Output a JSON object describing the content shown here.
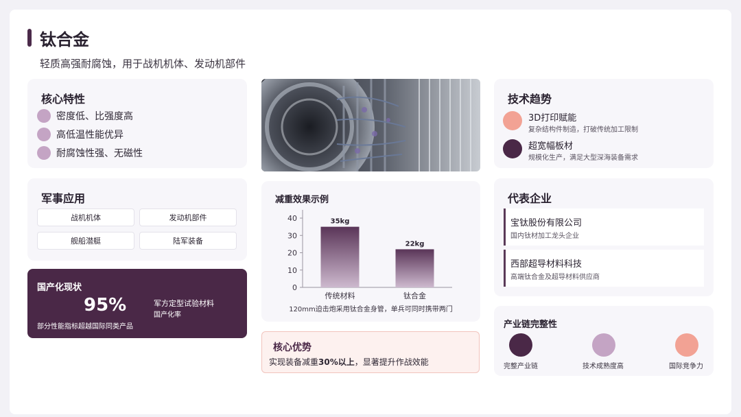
{
  "header": {
    "title": "钛合金",
    "subtitle": "轻质高强耐腐蚀，用于战机机体、发动机部件"
  },
  "core": {
    "title": "核心特性",
    "items": [
      "密度低、比强度高",
      "高低温性能优异",
      "耐腐蚀性强、无磁性"
    ]
  },
  "military": {
    "title": "军事应用",
    "items": [
      "战机机体",
      "发动机部件",
      "舰船潜艇",
      "陆军装备"
    ]
  },
  "status": {
    "title": "国产化现状",
    "percent": "95%",
    "line1": "军方定型试验材料",
    "line2": "国产化率",
    "footer": "部分性能指标超越国际同类产品"
  },
  "photo": {
    "icon": "jet-engine-photo"
  },
  "chart": {
    "title": "减重效果示例",
    "caption": "120mm迫击炮采用钛合金身管，单兵可同时携带两门"
  },
  "chart_data": {
    "type": "bar",
    "categories": [
      "传统材料",
      "钛合金"
    ],
    "values": [
      35,
      22
    ],
    "data_labels": [
      "35kg",
      "22kg"
    ],
    "ylim": [
      0,
      40
    ],
    "yticks": [
      "0",
      "10",
      "20",
      "30",
      "40"
    ],
    "title": "",
    "xlabel": "",
    "ylabel": "",
    "grid": false,
    "bar_color_top": "#5a3558",
    "bar_color_bottom": "#cdb9ce"
  },
  "advantage": {
    "title": "核心优势",
    "text_pre": "实现装备减重",
    "text_bold": "30%以上",
    "text_post": "，显著提升作战效能"
  },
  "trends": {
    "title": "技术趋势",
    "items": [
      {
        "title": "3D打印赋能",
        "desc": "复杂结构件制造，打破传统加工限制",
        "color": "#f2a294"
      },
      {
        "title": "超宽幅板材",
        "desc": "规模化生产，满足大型深海装备需求",
        "color": "#4a2847"
      }
    ]
  },
  "companies": {
    "title": "代表企业",
    "items": [
      {
        "name": "宝钛股份有限公司",
        "desc": "国内钛材加工龙头企业"
      },
      {
        "name": "西部超导材料科技",
        "desc": "高端钛合金及超导材料供应商"
      }
    ]
  },
  "chain": {
    "title": "产业链完整性",
    "items": [
      {
        "label": "完整产业链",
        "color": "#4a2847"
      },
      {
        "label": "技术成熟度高",
        "color": "#c4a4c4"
      },
      {
        "label": "国际竞争力",
        "color": "#f2a294"
      }
    ]
  }
}
